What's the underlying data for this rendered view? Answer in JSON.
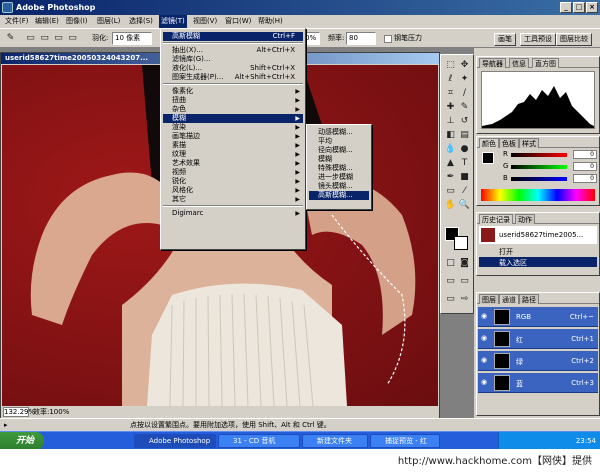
{
  "window": {
    "title": "Adobe Photoshop"
  },
  "menubar": [
    "文件(F)",
    "编辑(E)",
    "图像(I)",
    "图层(L)",
    "选择(S)",
    "滤镜(T)",
    "视图(V)",
    "窗口(W)",
    "帮助(H)"
  ],
  "options": {
    "feather_label": "羽化:",
    "feather_value": "10 像素",
    "opacity_value": "0%",
    "freq_label": "频率:",
    "freq_value": "80",
    "pressure_label": "钢笔压力",
    "tabs": [
      "画笔",
      "工具预设",
      "图层比较"
    ]
  },
  "document": {
    "title": "userid58627time20050324043207..."
  },
  "filter_menu": {
    "items": [
      {
        "label": "高斯模糊",
        "shortcut": "Ctrl+F",
        "highlight": true
      },
      {
        "sep": true
      },
      {
        "label": "抽出(X)...",
        "shortcut": "Alt+Ctrl+X"
      },
      {
        "label": "滤镜库(G)..."
      },
      {
        "label": "液化(L)...",
        "shortcut": "Shift+Ctrl+X"
      },
      {
        "label": "图案生成器(P)...",
        "shortcut": "Alt+Shift+Ctrl+X"
      },
      {
        "sep": true
      },
      {
        "label": "像素化",
        "sub": true
      },
      {
        "label": "扭曲",
        "sub": true
      },
      {
        "label": "杂色",
        "sub": true
      },
      {
        "label": "模糊",
        "sub": true,
        "highlight": true
      },
      {
        "label": "渲染",
        "sub": true
      },
      {
        "label": "画笔描边",
        "sub": true
      },
      {
        "label": "素描",
        "sub": true
      },
      {
        "label": "纹理",
        "sub": true
      },
      {
        "label": "艺术效果",
        "sub": true
      },
      {
        "label": "视频",
        "sub": true
      },
      {
        "label": "锐化",
        "sub": true
      },
      {
        "label": "风格化",
        "sub": true
      },
      {
        "label": "其它",
        "sub": true
      },
      {
        "sep": true
      },
      {
        "label": "Digimarc",
        "sub": true
      }
    ]
  },
  "blur_submenu": {
    "items": [
      {
        "label": "动感模糊..."
      },
      {
        "label": "平均"
      },
      {
        "label": "径向模糊..."
      },
      {
        "label": "模糊"
      },
      {
        "label": "特殊模糊..."
      },
      {
        "label": "进一步模糊"
      },
      {
        "label": "镜头模糊..."
      },
      {
        "label": "高斯模糊...",
        "highlight": true
      }
    ]
  },
  "navigator_panel": {
    "tabs": [
      "导航器",
      "信息",
      "直方图"
    ]
  },
  "color_panel": {
    "tabs": [
      "颜色",
      "色板",
      "样式"
    ],
    "rows": [
      {
        "label": "R",
        "value": "0"
      },
      {
        "label": "G",
        "value": "0"
      },
      {
        "label": "B",
        "value": "0"
      }
    ]
  },
  "history_panel": {
    "tabs": [
      "历史记录",
      "动作"
    ],
    "items": [
      "userid58627time2005...",
      "打开",
      "载入选区"
    ]
  },
  "channels_panel": {
    "tabs": [
      "图层",
      "通道",
      "路径"
    ],
    "rows": [
      {
        "name": "RGB",
        "shortcut": "Ctrl+~"
      },
      {
        "name": "红",
        "shortcut": "Ctrl+1"
      },
      {
        "name": "绿",
        "shortcut": "Ctrl+2"
      },
      {
        "name": "蓝",
        "shortcut": "Ctrl+3"
      }
    ]
  },
  "statusbar": {
    "zoom": "132.29%",
    "info": "效率:100%",
    "hint": "点按以设置繁围点。要用附加选项，使用 Shift、Alt 和 Ctrl 键。"
  },
  "taskbar": {
    "start": "开始",
    "tasks": [
      "Adobe Photoshop",
      "31 - CD 音机",
      "新建文件夹",
      "捕捉预览 - 红"
    ],
    "time": "23:54"
  },
  "watermark": "http://www.hackhome.com【网侠】提供"
}
